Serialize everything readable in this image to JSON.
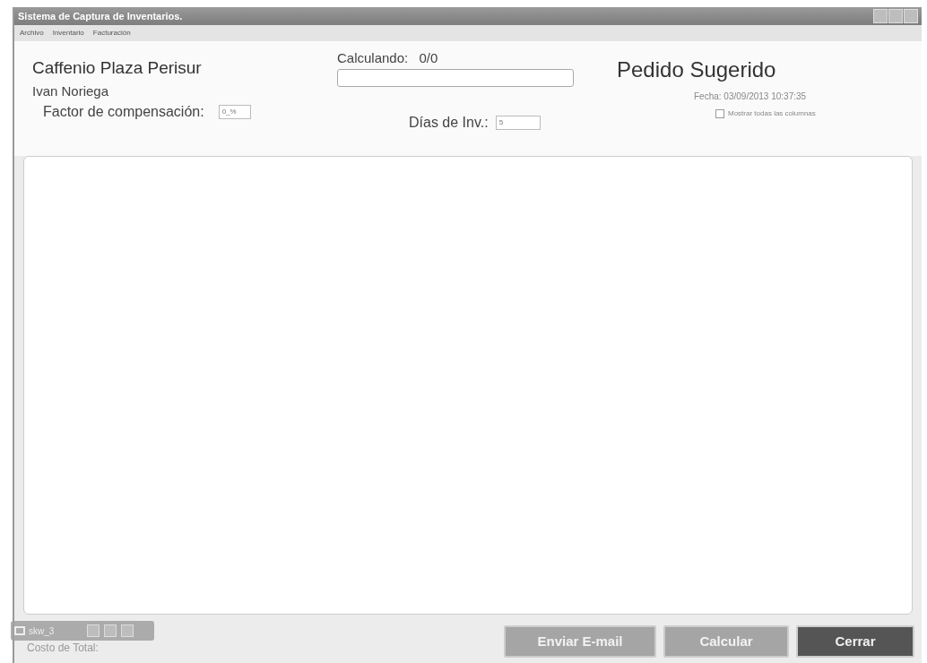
{
  "window": {
    "title": "Sistema de Captura de Inventarios."
  },
  "menu": [
    "Archivo",
    "Inventario",
    "Facturación"
  ],
  "header": {
    "store": "Caffenio Plaza Perisur",
    "user": "Ivan Noriega",
    "factor_label": "Factor de compensación:",
    "factor_value": "0_%",
    "progress_label": "Calculando:",
    "progress_count": "0/0",
    "progress": {
      "level": 0
    },
    "days_label": "Días de Inv.:",
    "days_value": "5",
    "title": "Pedido Sugerido",
    "date_label": "Fecha:",
    "date_value": "03/09/2013 10:37:35",
    "show_all": {
      "label": "Mostrar todas las columnas",
      "checked": false
    }
  },
  "footer": {
    "total_label": "Costo de Total:",
    "buttons": [
      {
        "label": "Enviar E-mail",
        "kind": "secondary"
      },
      {
        "label": "Calcular",
        "kind": "secondary"
      },
      {
        "label": "Cerrar",
        "kind": "primary"
      }
    ]
  },
  "minimized_window": {
    "title": "skw_3"
  }
}
